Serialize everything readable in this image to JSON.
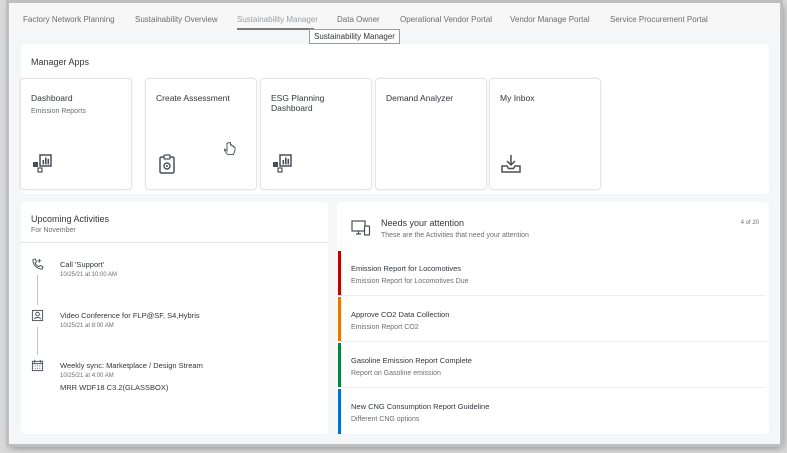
{
  "tabs": [
    {
      "label": "Factory Network Planning"
    },
    {
      "label": "Sustainability Overview"
    },
    {
      "label": "Sustainability Manager"
    },
    {
      "label": "Data Owner"
    },
    {
      "label": "Operational Vendor Portal"
    },
    {
      "label": "Vendor Manage Portal"
    },
    {
      "label": "Service Procurement Portal"
    }
  ],
  "active_tab_index": 2,
  "tooltip": "Sustainability Manager",
  "apps": {
    "title": "Manager Apps",
    "tiles": [
      {
        "title": "Dashboard",
        "subtitle": "Emission Reports",
        "icon": "analytics-icon"
      },
      {
        "title": "Create Assessment",
        "subtitle": "",
        "icon": "clipboard-icon"
      },
      {
        "title": "ESG Planning Dashboard",
        "subtitle": "",
        "icon": "analytics-icon"
      },
      {
        "title": "Demand Analyzer",
        "subtitle": "",
        "icon": "none"
      },
      {
        "title": "My Inbox",
        "subtitle": "",
        "icon": "download-inbox-icon"
      }
    ]
  },
  "activities": {
    "title": "Upcoming Activities",
    "subtitle": "For November",
    "items": [
      {
        "title": "Call 'Support'",
        "time": "10/25/21 at 10:00 AM",
        "extra": "",
        "icon": "phone-call-icon"
      },
      {
        "title": "Video Conference for FLP@SF, S4,Hybris",
        "time": "10/25/21 at 8:00 AM",
        "extra": "",
        "icon": "person-card-icon"
      },
      {
        "title": "Weekly sync: Marketplace / Design Stream",
        "time": "10/25/21 at 4:00 AM",
        "extra": "MRR WDF18 C3.2(GLASSBOX)",
        "icon": "calendar-icon"
      }
    ]
  },
  "attention": {
    "title": "Needs your attention",
    "subtitle": "These are the Activities that need your attention",
    "count": "4 of 20",
    "icon": "devices-icon",
    "items": [
      {
        "title": "Emission Report for Locomotives",
        "subtitle": "Emission Report for Locomotives Due",
        "color": "#bb0000"
      },
      {
        "title": "Approve CO2 Data Collection",
        "subtitle": "Emission Report CO2",
        "color": "#e9730c"
      },
      {
        "title": "Gasoline Emission Report Complete",
        "subtitle": "Report on Gasoline emission",
        "color": "#107e3e"
      },
      {
        "title": "New CNG Consumption Report Guideline",
        "subtitle": "Different CNG options",
        "color": "#0a6ed1"
      }
    ]
  }
}
